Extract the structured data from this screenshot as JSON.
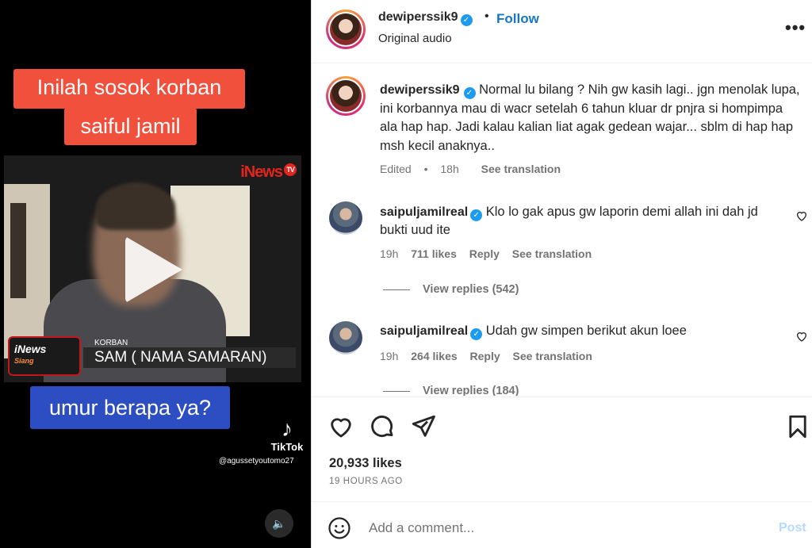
{
  "video": {
    "caption_top_line1": "Inilah sosok korban",
    "caption_top_line2": "saiful jamil",
    "channel_logo": "iNews",
    "channel_logo_tv": "TV",
    "badge_title": "iNews",
    "badge_sub": "Siang",
    "lower_third_label": "KORBAN",
    "lower_third_name": "SAM ( NAMA SAMARAN)",
    "caption_bottom": "umur berapa ya?",
    "tiktok_label": "TikTok",
    "tiktok_handle": "@agussetyoutomo27",
    "play_icon": "play-icon",
    "audio_icon": "speaker-icon"
  },
  "header": {
    "username": "dewiperssik9",
    "follow_label": "Follow",
    "dot": "•",
    "subtitle": "Original audio",
    "more_label": "•••"
  },
  "caption": {
    "username": "dewiperssik9",
    "text": "Normal lu bilang ? Nih gw kasih lagi.. jgn menolak lupa, ini korbannya mau di wacr setelah 6 tahun kluar dr pnjra si hompimpa ala hap hap. Jadi kalau kalian liat agak gedean wajar... sblm di hap hap msh kecil anaknya..",
    "edited": "Edited",
    "sep": "•",
    "time": "18h",
    "translate": "See translation"
  },
  "comments": [
    {
      "username": "saipuljamilreal",
      "text": "Klo lo gak apus gw laporin demi allah ini dah jd bukti uud ite",
      "time": "19h",
      "likes": "711 likes",
      "reply": "Reply",
      "translate": "See translation",
      "view_replies": "View replies (542)"
    },
    {
      "username": "saipuljamilreal",
      "text": "Udah gw simpen berikut akun loee",
      "time": "19h",
      "likes": "264 likes",
      "reply": "Reply",
      "translate": "See translation",
      "view_replies": "View replies (184)"
    }
  ],
  "post": {
    "likes": "20,933 likes",
    "time_ago": "19 HOURS AGO"
  },
  "add_comment": {
    "placeholder": "Add a comment...",
    "post_label": "Post"
  },
  "colors": {
    "accent": "#1877c4",
    "verified": "#1d9bf0",
    "muted": "#737373",
    "caption_red": "#f0503c",
    "caption_blue": "#2c4ec2"
  }
}
